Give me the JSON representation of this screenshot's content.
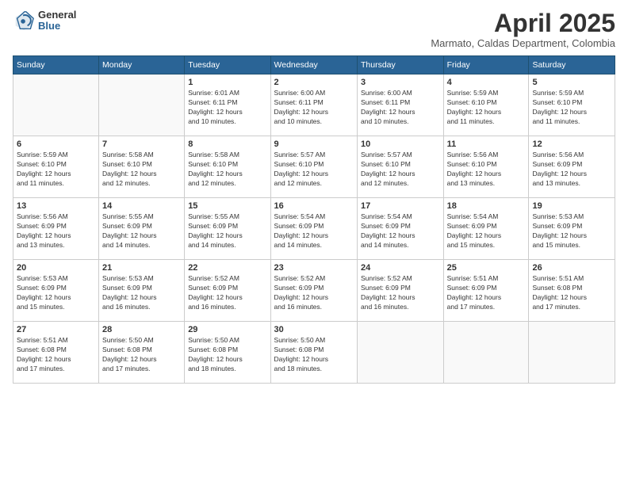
{
  "logo": {
    "general": "General",
    "blue": "Blue"
  },
  "title": "April 2025",
  "location": "Marmato, Caldas Department, Colombia",
  "headers": [
    "Sunday",
    "Monday",
    "Tuesday",
    "Wednesday",
    "Thursday",
    "Friday",
    "Saturday"
  ],
  "weeks": [
    [
      {
        "day": "",
        "info": ""
      },
      {
        "day": "",
        "info": ""
      },
      {
        "day": "1",
        "info": "Sunrise: 6:01 AM\nSunset: 6:11 PM\nDaylight: 12 hours\nand 10 minutes."
      },
      {
        "day": "2",
        "info": "Sunrise: 6:00 AM\nSunset: 6:11 PM\nDaylight: 12 hours\nand 10 minutes."
      },
      {
        "day": "3",
        "info": "Sunrise: 6:00 AM\nSunset: 6:11 PM\nDaylight: 12 hours\nand 10 minutes."
      },
      {
        "day": "4",
        "info": "Sunrise: 5:59 AM\nSunset: 6:10 PM\nDaylight: 12 hours\nand 11 minutes."
      },
      {
        "day": "5",
        "info": "Sunrise: 5:59 AM\nSunset: 6:10 PM\nDaylight: 12 hours\nand 11 minutes."
      }
    ],
    [
      {
        "day": "6",
        "info": "Sunrise: 5:59 AM\nSunset: 6:10 PM\nDaylight: 12 hours\nand 11 minutes."
      },
      {
        "day": "7",
        "info": "Sunrise: 5:58 AM\nSunset: 6:10 PM\nDaylight: 12 hours\nand 12 minutes."
      },
      {
        "day": "8",
        "info": "Sunrise: 5:58 AM\nSunset: 6:10 PM\nDaylight: 12 hours\nand 12 minutes."
      },
      {
        "day": "9",
        "info": "Sunrise: 5:57 AM\nSunset: 6:10 PM\nDaylight: 12 hours\nand 12 minutes."
      },
      {
        "day": "10",
        "info": "Sunrise: 5:57 AM\nSunset: 6:10 PM\nDaylight: 12 hours\nand 12 minutes."
      },
      {
        "day": "11",
        "info": "Sunrise: 5:56 AM\nSunset: 6:10 PM\nDaylight: 12 hours\nand 13 minutes."
      },
      {
        "day": "12",
        "info": "Sunrise: 5:56 AM\nSunset: 6:09 PM\nDaylight: 12 hours\nand 13 minutes."
      }
    ],
    [
      {
        "day": "13",
        "info": "Sunrise: 5:56 AM\nSunset: 6:09 PM\nDaylight: 12 hours\nand 13 minutes."
      },
      {
        "day": "14",
        "info": "Sunrise: 5:55 AM\nSunset: 6:09 PM\nDaylight: 12 hours\nand 14 minutes."
      },
      {
        "day": "15",
        "info": "Sunrise: 5:55 AM\nSunset: 6:09 PM\nDaylight: 12 hours\nand 14 minutes."
      },
      {
        "day": "16",
        "info": "Sunrise: 5:54 AM\nSunset: 6:09 PM\nDaylight: 12 hours\nand 14 minutes."
      },
      {
        "day": "17",
        "info": "Sunrise: 5:54 AM\nSunset: 6:09 PM\nDaylight: 12 hours\nand 14 minutes."
      },
      {
        "day": "18",
        "info": "Sunrise: 5:54 AM\nSunset: 6:09 PM\nDaylight: 12 hours\nand 15 minutes."
      },
      {
        "day": "19",
        "info": "Sunrise: 5:53 AM\nSunset: 6:09 PM\nDaylight: 12 hours\nand 15 minutes."
      }
    ],
    [
      {
        "day": "20",
        "info": "Sunrise: 5:53 AM\nSunset: 6:09 PM\nDaylight: 12 hours\nand 15 minutes."
      },
      {
        "day": "21",
        "info": "Sunrise: 5:53 AM\nSunset: 6:09 PM\nDaylight: 12 hours\nand 16 minutes."
      },
      {
        "day": "22",
        "info": "Sunrise: 5:52 AM\nSunset: 6:09 PM\nDaylight: 12 hours\nand 16 minutes."
      },
      {
        "day": "23",
        "info": "Sunrise: 5:52 AM\nSunset: 6:09 PM\nDaylight: 12 hours\nand 16 minutes."
      },
      {
        "day": "24",
        "info": "Sunrise: 5:52 AM\nSunset: 6:09 PM\nDaylight: 12 hours\nand 16 minutes."
      },
      {
        "day": "25",
        "info": "Sunrise: 5:51 AM\nSunset: 6:09 PM\nDaylight: 12 hours\nand 17 minutes."
      },
      {
        "day": "26",
        "info": "Sunrise: 5:51 AM\nSunset: 6:08 PM\nDaylight: 12 hours\nand 17 minutes."
      }
    ],
    [
      {
        "day": "27",
        "info": "Sunrise: 5:51 AM\nSunset: 6:08 PM\nDaylight: 12 hours\nand 17 minutes."
      },
      {
        "day": "28",
        "info": "Sunrise: 5:50 AM\nSunset: 6:08 PM\nDaylight: 12 hours\nand 17 minutes."
      },
      {
        "day": "29",
        "info": "Sunrise: 5:50 AM\nSunset: 6:08 PM\nDaylight: 12 hours\nand 18 minutes."
      },
      {
        "day": "30",
        "info": "Sunrise: 5:50 AM\nSunset: 6:08 PM\nDaylight: 12 hours\nand 18 minutes."
      },
      {
        "day": "",
        "info": ""
      },
      {
        "day": "",
        "info": ""
      },
      {
        "day": "",
        "info": ""
      }
    ]
  ]
}
